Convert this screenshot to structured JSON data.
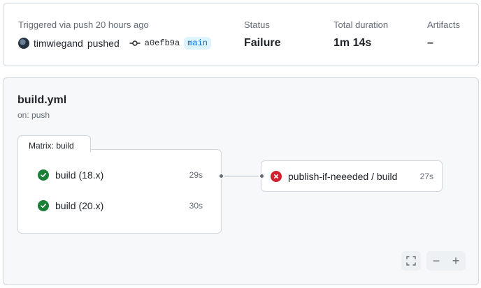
{
  "summary": {
    "trigger_text": "Triggered via push 20 hours ago",
    "user": "timwiegand",
    "action": "pushed",
    "commit_sha": "a0efb9a",
    "branch": "main",
    "status_label": "Status",
    "status_value": "Failure",
    "duration_label": "Total duration",
    "duration_value": "1m 14s",
    "artifacts_label": "Artifacts",
    "artifacts_value": "–"
  },
  "workflow": {
    "file": "build.yml",
    "trigger": "on: push",
    "matrix_label": "Matrix: build",
    "matrix_jobs": [
      {
        "name": "build (18.x)",
        "duration": "29s",
        "status": "success"
      },
      {
        "name": "build (20.x)",
        "duration": "30s",
        "status": "success"
      }
    ],
    "downstream_job": {
      "name": "publish-if-neeeded / build",
      "duration": "27s",
      "status": "failure"
    }
  },
  "controls": {
    "zoom_out": "−",
    "zoom_in": "+"
  },
  "colors": {
    "success": "#1a7f37",
    "failure": "#cf222e",
    "branch_accent": "#0969da"
  }
}
